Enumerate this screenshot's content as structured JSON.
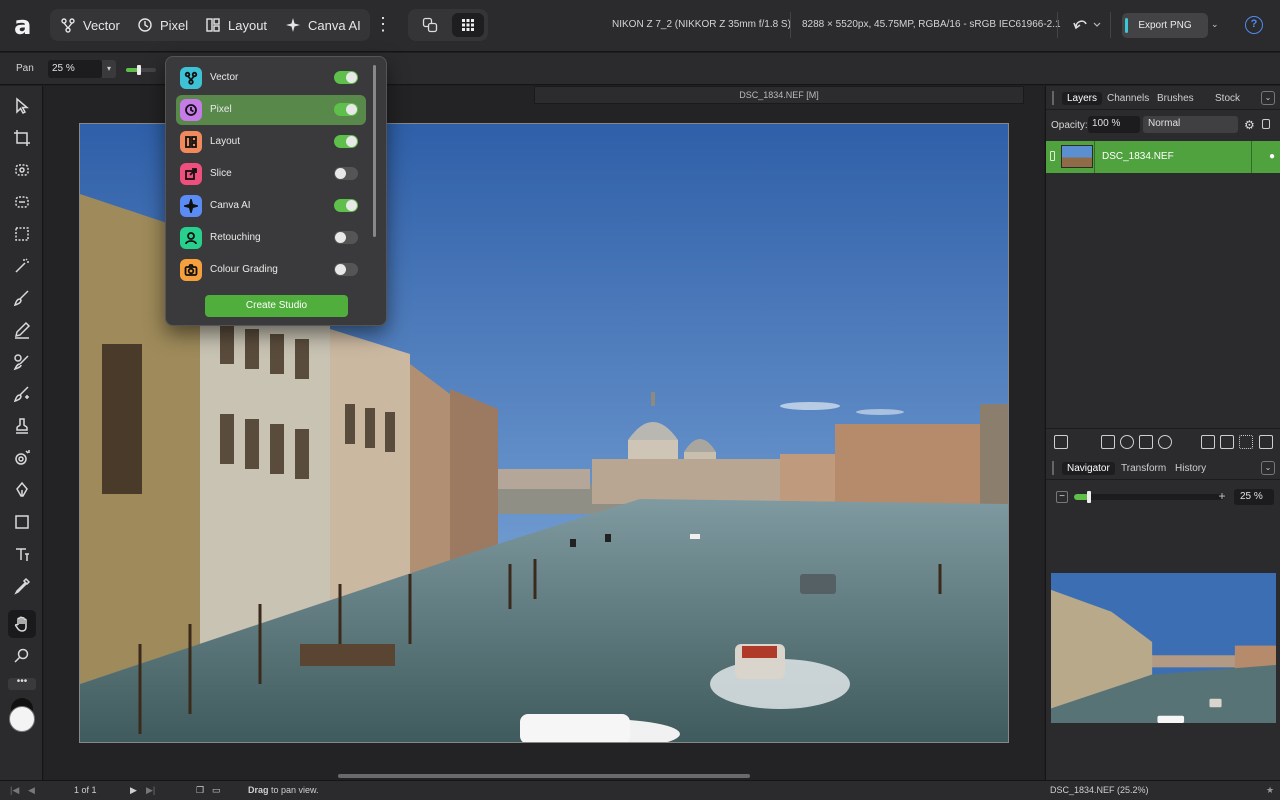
{
  "app": {
    "logo": "a"
  },
  "studios": [
    {
      "label": "Vector",
      "icon": "vector-icon"
    },
    {
      "label": "Pixel",
      "icon": "pixel-icon"
    },
    {
      "label": "Layout",
      "icon": "layout-icon"
    },
    {
      "label": "Canva AI",
      "icon": "canva-ai-icon"
    }
  ],
  "document_info": {
    "camera": "NIKON Z 7_2 (NIKKOR Z 35mm f/1.8 S)",
    "specs": "8288 × 5520px, 45.75MP, RGBA/16 - sRGB IEC61966-2.1"
  },
  "export": {
    "label": "Export PNG",
    "accent": "#3cc6d8"
  },
  "help_label": "?",
  "context_toolbar": {
    "tool_label": "Pan",
    "zoom_value": "25 %"
  },
  "document_tab": "DSC_1834.NEF [M]",
  "studio_menu": {
    "items": [
      {
        "label": "Vector",
        "enabled": true,
        "color": "#3ec3d6",
        "icon": "vector-icon"
      },
      {
        "label": "Pixel",
        "enabled": true,
        "color": "#c77be8",
        "icon": "pixel-icon",
        "selected": true
      },
      {
        "label": "Layout",
        "enabled": true,
        "color": "#f08a5d",
        "icon": "layout-icon"
      },
      {
        "label": "Slice",
        "enabled": false,
        "color": "#ee4f7d",
        "icon": "slice-icon"
      },
      {
        "label": "Canva AI",
        "enabled": true,
        "color": "#5b8cf5",
        "icon": "canva-ai-icon"
      },
      {
        "label": "Retouching",
        "enabled": false,
        "color": "#27d08c",
        "icon": "retouching-icon"
      },
      {
        "label": "Colour Grading",
        "enabled": false,
        "color": "#f5a03c",
        "icon": "colour-grading-icon"
      }
    ],
    "create_label": "Create Studio"
  },
  "right_panel": {
    "tabs": [
      "Layers",
      "Channels",
      "Brushes",
      "Stock"
    ],
    "opacity_label": "Opacity:",
    "opacity_value": "100 %",
    "blend_mode": "Normal",
    "layer_name": "DSC_1834.NEF",
    "nav_tabs": [
      "Navigator",
      "Transform",
      "History"
    ],
    "nav_zoom": "25 %",
    "nav_zoom_fraction": 0.1
  },
  "status": {
    "page": "1 of 1",
    "hint_bold": "Drag",
    "hint_rest": "to pan view.",
    "file_zoom": "DSC_1834.NEF (25.2%)"
  },
  "colors": {
    "accent_green": "#5fbf4b",
    "selected_layer": "#4fa23e"
  }
}
